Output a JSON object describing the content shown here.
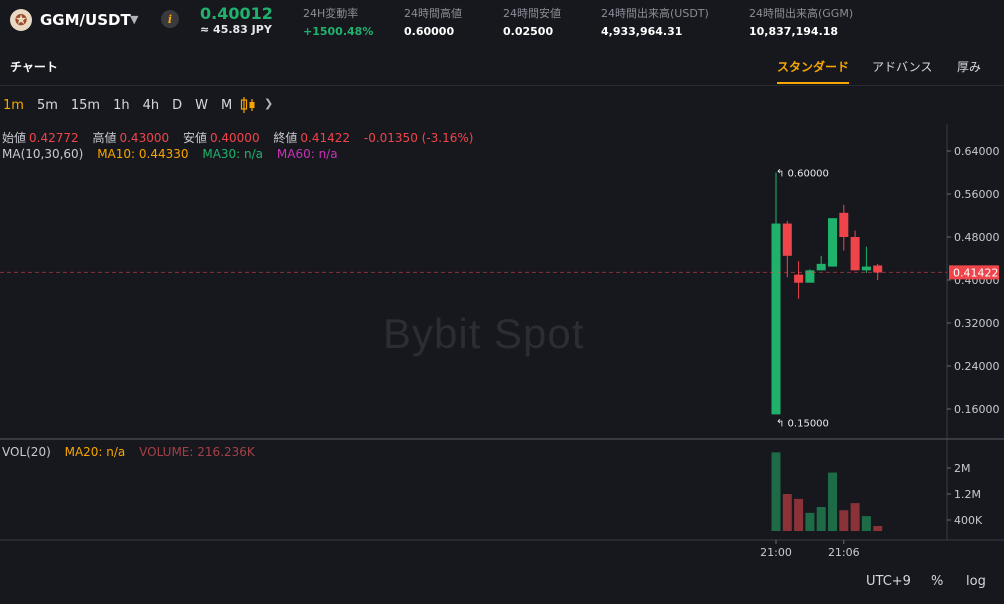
{
  "ticker": {
    "pair": "GGM/USDT",
    "last_price": "0.40012",
    "fiat_value": "≈ 45.83 JPY",
    "stats": [
      {
        "label": "24H変動率",
        "value": "+1500.48%",
        "positive": true
      },
      {
        "label": "24時間高値",
        "value": "0.60000",
        "positive": false
      },
      {
        "label": "24時間安値",
        "value": "0.02500",
        "positive": false
      },
      {
        "label": "24時間出来高(USDT)",
        "value": "4,933,964.31",
        "positive": false
      },
      {
        "label": "24時間出来高(GGM)",
        "value": "10,837,194.18",
        "positive": false
      }
    ]
  },
  "tabs": {
    "chart": "チャート",
    "views": [
      "スタンダード",
      "アドバンス",
      "厚み"
    ],
    "active_view": "スタンダード"
  },
  "intervals": {
    "items": [
      "1m",
      "5m",
      "15m",
      "1h",
      "4h",
      "D",
      "W",
      "M"
    ],
    "active": "1m"
  },
  "ohlc": {
    "open_label": "始値",
    "open": "0.42772",
    "high_label": "高値",
    "high": "0.43000",
    "low_label": "安値",
    "low": "0.40000",
    "close_label": "終値",
    "close": "0.41422",
    "change": "-0.01350 (-3.16%)"
  },
  "ma": {
    "label": "MA(10,30,60)",
    "ma10": "MA10: 0.44330",
    "ma30": "MA30: n/a",
    "ma60": "MA60: n/a"
  },
  "volume_legend": {
    "label": "VOL(20)",
    "ma20": "MA20: n/a",
    "volume": "VOLUME: 216.236K"
  },
  "watermark": "Bybit Spot",
  "bottom_toolbar": {
    "timezone": "UTC+9",
    "percent": "%",
    "log": "log"
  },
  "colors": {
    "up": "#20b26c",
    "down": "#ef454a",
    "accent": "#f7a600",
    "background": "#17181e"
  },
  "chart_data": {
    "type": "candlestick",
    "price_axis_ticks": [
      "0.64000",
      "0.56000",
      "0.48000",
      "0.40000",
      "0.32000",
      "0.24000",
      "0.16000"
    ],
    "price_axis_values": [
      0.64,
      0.56,
      0.48,
      0.4,
      0.32,
      0.24,
      0.16
    ],
    "current_price_label": "0.41422",
    "current_price": 0.41422,
    "high_marker": "0.60000",
    "low_marker": "0.15000",
    "volume_axis_ticks": [
      "2M",
      "1.2M",
      "400K"
    ],
    "volume_axis_values": [
      2000000,
      1200000,
      400000
    ],
    "time_ticks": [
      "21:00",
      "21:06"
    ],
    "time_tick_index": [
      0,
      6
    ],
    "candles": [
      {
        "o": 0.15,
        "h": 0.6,
        "l": 0.15,
        "c": 0.505
      },
      {
        "o": 0.505,
        "h": 0.51,
        "l": 0.405,
        "c": 0.445
      },
      {
        "o": 0.41,
        "h": 0.435,
        "l": 0.365,
        "c": 0.395
      },
      {
        "o": 0.395,
        "h": 0.42,
        "l": 0.395,
        "c": 0.418
      },
      {
        "o": 0.418,
        "h": 0.445,
        "l": 0.418,
        "c": 0.43
      },
      {
        "o": 0.425,
        "h": 0.515,
        "l": 0.425,
        "c": 0.515
      },
      {
        "o": 0.525,
        "h": 0.54,
        "l": 0.455,
        "c": 0.48
      },
      {
        "o": 0.48,
        "h": 0.492,
        "l": 0.418,
        "c": 0.418
      },
      {
        "o": 0.418,
        "h": 0.462,
        "l": 0.413,
        "c": 0.425
      },
      {
        "o": 0.427,
        "h": 0.43,
        "l": 0.4,
        "c": 0.414
      }
    ],
    "volumes": [
      2480000,
      1200000,
      1050000,
      620000,
      800000,
      1860000,
      700000,
      920000,
      520000,
      216236
    ]
  }
}
